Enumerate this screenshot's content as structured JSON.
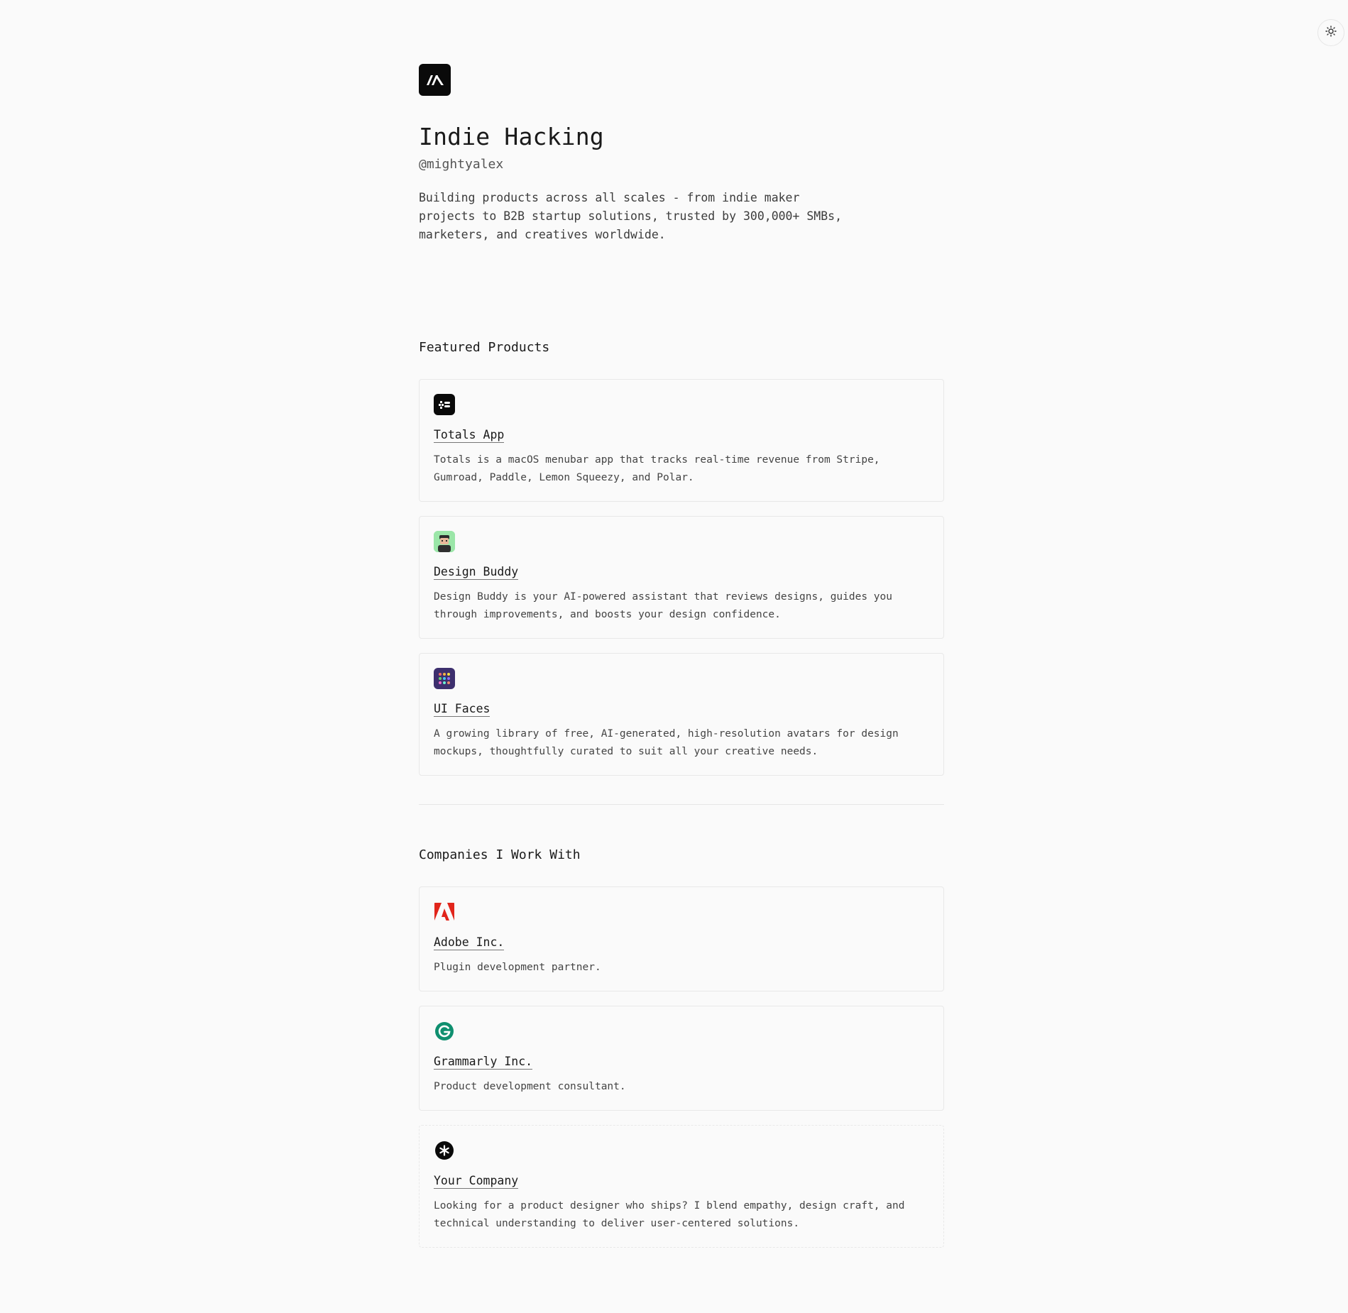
{
  "profile": {
    "title": "Indie Hacking",
    "handle": "@mightyalex",
    "bio": "Building products across all scales - from indie maker projects to B2B startup solutions, trusted by 300,000+ SMBs, marketers, and creatives worldwide."
  },
  "featured": {
    "heading": "Featured Products",
    "items": [
      {
        "name": "Totals App",
        "description": "Totals is a macOS menubar app that tracks real-time revenue from Stripe, Gumroad, Paddle, Lemon Squeezy, and Polar.",
        "icon": "totals-app-icon"
      },
      {
        "name": "Design Buddy",
        "description": "Design Buddy is your AI-powered assistant that reviews designs, guides you through improvements, and boosts your design confidence.",
        "icon": "design-buddy-icon"
      },
      {
        "name": "UI Faces",
        "description": "A growing library of free, AI-generated, high-resolution avatars for design mockups, thoughtfully curated to suit all your creative needs.",
        "icon": "ui-faces-icon"
      }
    ]
  },
  "companies": {
    "heading": "Companies I Work With",
    "items": [
      {
        "name": "Adobe Inc.",
        "description": "Plugin development partner.",
        "icon": "adobe-icon"
      },
      {
        "name": "Grammarly Inc.",
        "description": "Product development consultant.",
        "icon": "grammarly-icon"
      },
      {
        "name": "Your Company",
        "description": "Looking for a product designer who ships? I blend empathy, design craft, and technical understanding to deliver user-centered solutions.",
        "icon": "asterisk-icon"
      }
    ]
  },
  "colors": {
    "background": "#fafafa",
    "text": "#1f1f1f",
    "border": "#e8e8e8",
    "adobe_red": "#e1251b",
    "grammarly_green": "#15c39a"
  }
}
